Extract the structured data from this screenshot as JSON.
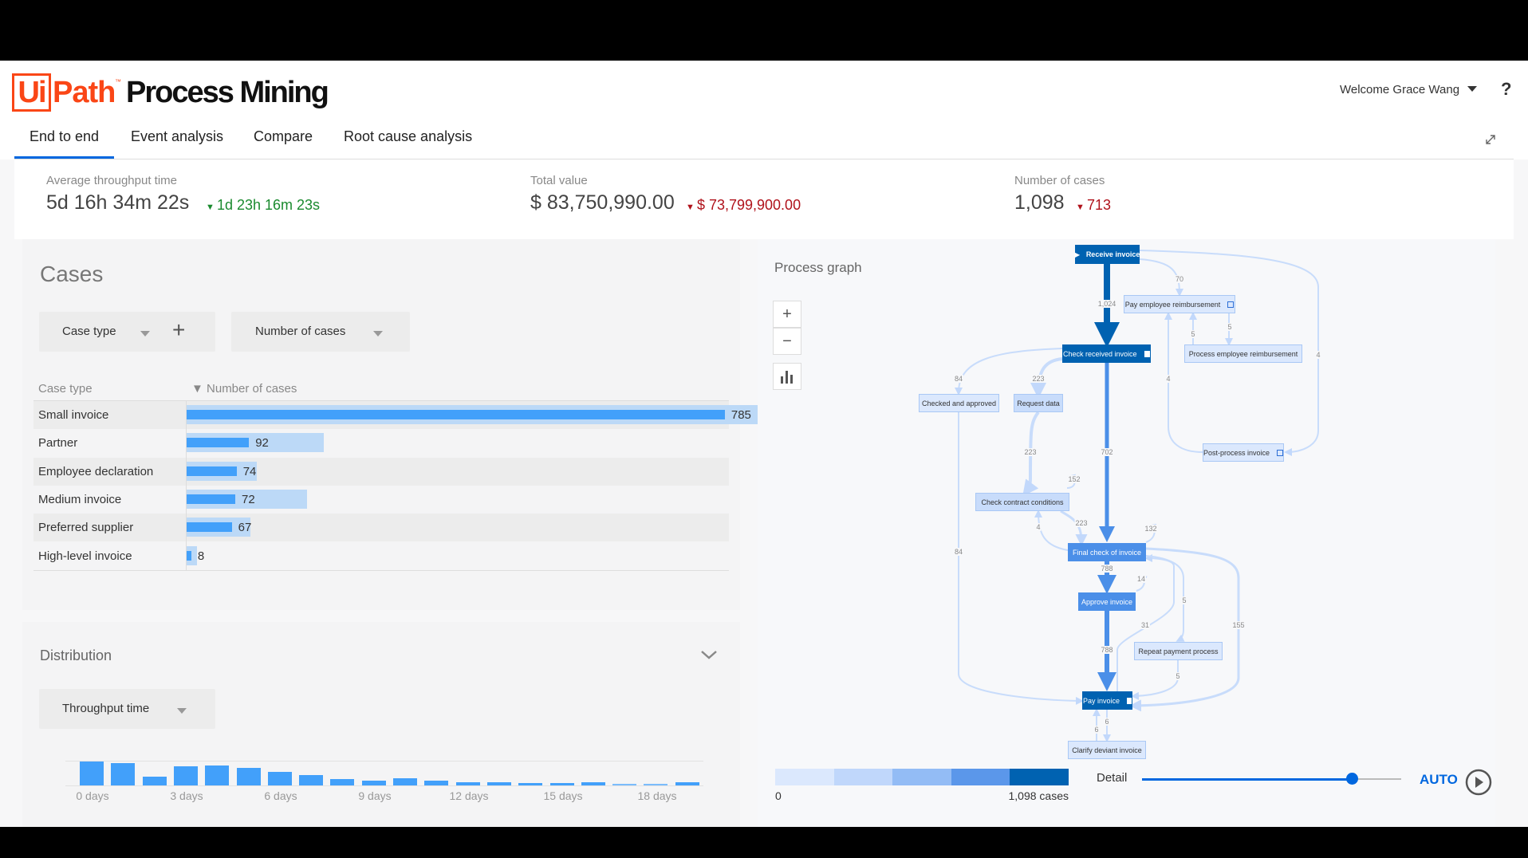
{
  "app": {
    "brand_ui": "Ui",
    "brand_path": "Path",
    "brand_tm": "™",
    "product": "Process Mining",
    "brand_color": "#fa4616"
  },
  "user": {
    "welcome": "Welcome Grace Wang",
    "help": "?"
  },
  "tabs": [
    {
      "label": "End to end",
      "active": true
    },
    {
      "label": "Event analysis"
    },
    {
      "label": "Compare"
    },
    {
      "label": "Root cause analysis"
    }
  ],
  "kpis": [
    {
      "label": "Average throughput time",
      "value": "5d 16h 34m 22s",
      "delta": "1d 23h 16m 23s",
      "delta_color": "#1a8a2e",
      "direction": "down"
    },
    {
      "label": "Total value",
      "value": "$ 83,750,990.00",
      "delta": "$ 73,799,900.00",
      "delta_color": "#b0121b",
      "direction": "down"
    },
    {
      "label": "Number of cases",
      "value": "1,098",
      "delta": "713",
      "delta_color": "#b0121b",
      "direction": "down"
    }
  ],
  "cases": {
    "title": "Cases",
    "dropdown1": "Case type",
    "dropdown2": "Number of cases",
    "col1": "Case type",
    "col2": "▼ Number of cases",
    "rows": [
      {
        "label": "Small invoice",
        "value": 785,
        "value_text": "785",
        "compare": 1227
      },
      {
        "label": "Partner",
        "value": 92,
        "value_text": "92",
        "compare": 201
      },
      {
        "label": "Employee declaration",
        "value": 74,
        "value_text": "74",
        "compare": 103
      },
      {
        "label": "Medium invoice",
        "value": 72,
        "value_text": "72",
        "compare": 177
      },
      {
        "label": "Preferred supplier",
        "value": 67,
        "value_text": "67",
        "compare": 94
      },
      {
        "label": "High-level invoice",
        "value": 8,
        "value_text": "8",
        "compare": 16
      }
    ]
  },
  "distribution": {
    "title": "Distribution",
    "dropdown": "Throughput time",
    "chart_data": {
      "type": "bar",
      "xlabel": "",
      "ylabel": "",
      "x_ticks": [
        "0 days",
        "3 days",
        "6 days",
        "9 days",
        "12 days",
        "15 days",
        "18 days"
      ],
      "values": [
        85,
        79,
        31,
        67,
        70,
        61,
        49,
        37,
        22,
        18,
        26,
        17,
        10,
        10,
        9,
        9,
        10,
        5,
        5,
        10
      ]
    }
  },
  "graph": {
    "title": "Process graph",
    "zoom_in": "+",
    "zoom_out": "−",
    "nodes": {
      "receive": "Receive invoice",
      "pay_emp": "Pay employee reimbursement",
      "check_recv": "Check received invoice",
      "proc_emp": "Process employee reimbursement",
      "checked": "Checked and approved",
      "request": "Request data",
      "post": "Post-process invoice",
      "contract": "Check contract conditions",
      "final": "Final check of invoice",
      "approve": "Approve invoice",
      "repeat": "Repeat payment process",
      "pay": "Pay invoice",
      "clarify": "Clarify deviant invoice"
    },
    "edges": [
      "1,024",
      "70",
      "4",
      "5",
      "5",
      "4",
      "84",
      "223",
      "702",
      "223",
      "152",
      "223",
      "4",
      "84",
      "132",
      "788",
      "14",
      "788",
      "31",
      "5",
      "5",
      "155",
      "6",
      "6"
    ],
    "legend": {
      "min": "0",
      "max": "1,098 cases",
      "colors": [
        "#dbe8fd",
        "#c0d7fb",
        "#93bcf5",
        "#5b97ea",
        "#0062b1"
      ]
    },
    "detail_label": "Detail",
    "detail_level": 0.81,
    "auto": "AUTO"
  }
}
